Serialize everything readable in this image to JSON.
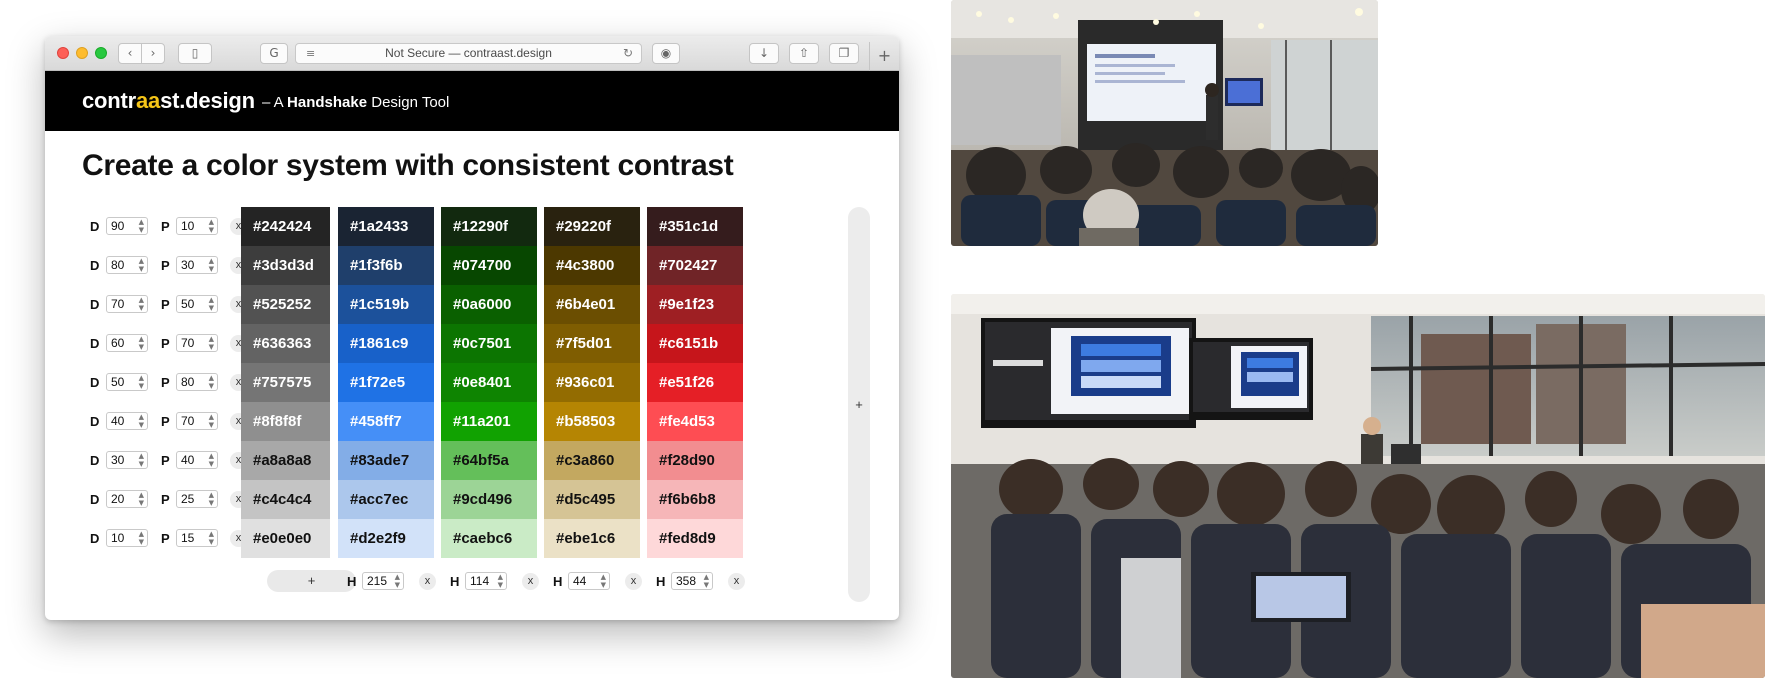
{
  "browser": {
    "url": "Not Secure — contraast.design",
    "icons": [
      "back-arrow-icon",
      "forward-arrow-icon",
      "sidebar-icon",
      "grammarly-icon",
      "reader-icon",
      "reload-icon",
      "privacy-icon",
      "download-icon",
      "share-icon",
      "tabs-icon",
      "new-tab-icon"
    ]
  },
  "app": {
    "logo": {
      "part1": "contr",
      "part2": "aa",
      "part3": "st.design"
    },
    "tagline": {
      "dash": "– A ",
      "brand": "Handshake",
      "rest": " Design Tool"
    },
    "title": "Create a color system with consistent contrast",
    "accent_color": "#f5c518"
  },
  "controls": [
    {
      "d_label": "D",
      "d": "90",
      "p_label": "P",
      "p": "10",
      "remove": "x"
    },
    {
      "d_label": "D",
      "d": "80",
      "p_label": "P",
      "p": "30",
      "remove": "x"
    },
    {
      "d_label": "D",
      "d": "70",
      "p_label": "P",
      "p": "50",
      "remove": "x"
    },
    {
      "d_label": "D",
      "d": "60",
      "p_label": "P",
      "p": "70",
      "remove": "x"
    },
    {
      "d_label": "D",
      "d": "50",
      "p_label": "P",
      "p": "80",
      "remove": "x"
    },
    {
      "d_label": "D",
      "d": "40",
      "p_label": "P",
      "p": "70",
      "remove": "x"
    },
    {
      "d_label": "D",
      "d": "30",
      "p_label": "P",
      "p": "40",
      "remove": "x"
    },
    {
      "d_label": "D",
      "d": "20",
      "p_label": "P",
      "p": "25",
      "remove": "x"
    },
    {
      "d_label": "D",
      "d": "10",
      "p_label": "P",
      "p": "15",
      "remove": "x"
    }
  ],
  "gray_column": {
    "colors": [
      "#242424",
      "#3d3d3d",
      "#525252",
      "#636363",
      "#757575",
      "#8f8f8f",
      "#a8a8a8",
      "#c4c4c4",
      "#e0e0e0"
    ],
    "add_label": "+"
  },
  "hue_columns": [
    {
      "h_label": "H",
      "hue": "215",
      "remove": "x",
      "colors": [
        "#1a2433",
        "#1f3f6b",
        "#1c519b",
        "#1861c9",
        "#1f72e5",
        "#458ff7",
        "#83ade7",
        "#acc7ec",
        "#d2e2f9"
      ]
    },
    {
      "h_label": "H",
      "hue": "114",
      "remove": "x",
      "colors": [
        "#12290f",
        "#074700",
        "#0a6000",
        "#0c7501",
        "#0e8401",
        "#11a201",
        "#64bf5a",
        "#9cd496",
        "#caebc6"
      ]
    },
    {
      "h_label": "H",
      "hue": "44",
      "remove": "x",
      "colors": [
        "#29220f",
        "#4c3800",
        "#6b4e01",
        "#7f5d01",
        "#936c01",
        "#b58503",
        "#c3a860",
        "#d5c495",
        "#ebe1c6"
      ]
    },
    {
      "h_label": "H",
      "hue": "358",
      "remove": "x",
      "colors": [
        "#351c1d",
        "#702427",
        "#9e1f23",
        "#c6151b",
        "#e51f26",
        "#fe4d53",
        "#f28d90",
        "#f6b6b8",
        "#fed8d9"
      ]
    }
  ],
  "add_column_label": "+",
  "photos": [
    "presentation-photo-top",
    "presentation-photo-bottom"
  ]
}
